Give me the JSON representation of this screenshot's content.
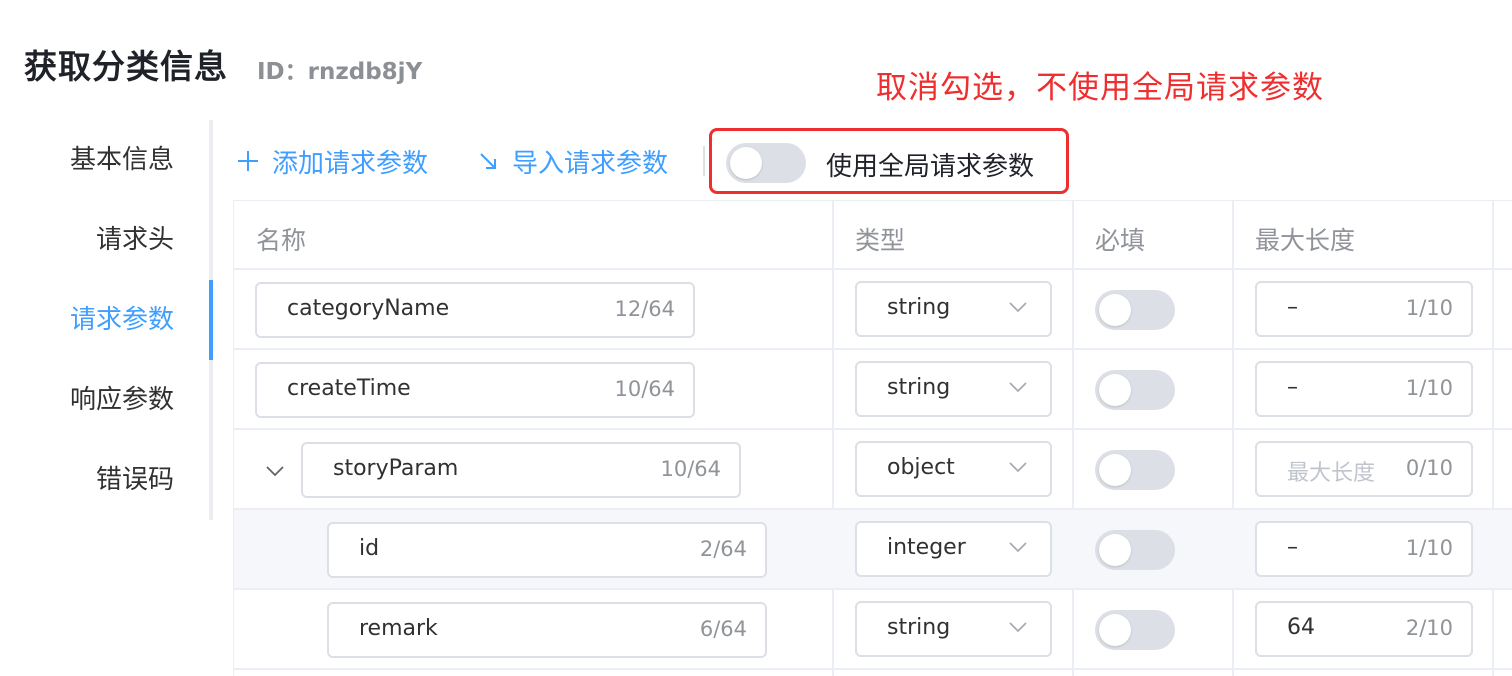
{
  "page": {
    "title": "获取分类信息",
    "id_text": "ID：rnzdb8jY",
    "annotation": "取消勾选，不使用全局请求参数"
  },
  "sidebar": {
    "items": [
      {
        "label": "基本信息"
      },
      {
        "label": "请求头"
      },
      {
        "label": "请求参数",
        "active": true
      },
      {
        "label": "响应参数"
      },
      {
        "label": "错误码"
      }
    ]
  },
  "toolbar": {
    "add_icon": "plus-icon",
    "add_label": "添加请求参数",
    "import_icon": "arrow-down-right-icon",
    "import_label": "导入请求参数",
    "global_toggle_label": "使用全局请求参数",
    "global_toggle_on": false
  },
  "table": {
    "headers": [
      "名称",
      "类型",
      "必填",
      "最大长度"
    ],
    "rows": [
      {
        "name": "categoryName",
        "name_count": "12/64",
        "type": "string",
        "required": false,
        "maxlen": "–",
        "maxlen_count": "1/10"
      },
      {
        "name": "createTime",
        "name_count": "10/64",
        "type": "string",
        "required": false,
        "maxlen": "–",
        "maxlen_count": "1/10"
      },
      {
        "name": "storyParam",
        "name_count": "10/64",
        "type": "object",
        "required": false,
        "maxlen": "",
        "maxlen_placeholder": "最大长度",
        "maxlen_count": "0/10",
        "expanded": true
      },
      {
        "name": "id",
        "name_count": "2/64",
        "type": "integer",
        "required": false,
        "maxlen": "–",
        "maxlen_count": "1/10",
        "child": true
      },
      {
        "name": "remark",
        "name_count": "6/64",
        "type": "string",
        "required": false,
        "maxlen": "64",
        "maxlen_count": "2/10",
        "child": true
      }
    ]
  },
  "colors": {
    "accent": "#409eff",
    "annotation": "#ef2f2f",
    "toggle_off": "#dcdfe6"
  }
}
